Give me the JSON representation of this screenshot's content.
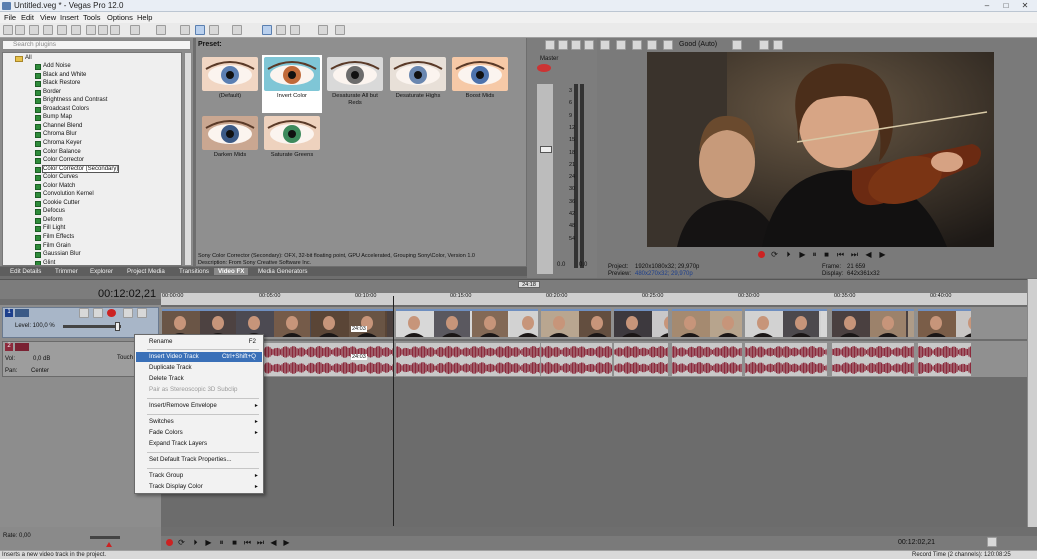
{
  "window": {
    "title": "Untitled.veg * - Vegas Pro 12.0",
    "minimize": "–",
    "maximize": "□",
    "close": "✕"
  },
  "menu": [
    "File",
    "Edit",
    "View",
    "Insert",
    "Tools",
    "Options",
    "Help"
  ],
  "fx": {
    "search_placeholder": "Search plugins",
    "root": "All",
    "items": [
      "Add Noise",
      "Black and White",
      "Black Restore",
      "Border",
      "Brightness and Contrast",
      "Broadcast Colors",
      "Bump Map",
      "Channel Blend",
      "Chroma Blur",
      "Chroma Keyer",
      "Color Balance",
      "Color Corrector",
      "Color Corrector (Secondary)",
      "Color Curves",
      "Color Match",
      "Convolution Kernel",
      "Cookie Cutter",
      "Defocus",
      "Deform",
      "Fill Light",
      "Film Effects",
      "Film Grain",
      "Gaussian Blur",
      "Glint"
    ],
    "selected": "Color Corrector (Secondary)"
  },
  "presets": {
    "label": "Preset:",
    "items": [
      "(Default)",
      "Invert Color",
      "Desaturate All but Reds",
      "Desaturate Highs",
      "Boost Mids",
      "Darken Mids",
      "Saturate Greens"
    ],
    "selected": "Invert Color",
    "description_line1": "Sony Color Corrector (Secondary): OFX, 32-bit floating point, GPU Accelerated, Grouping Sony\\Color, Version 1.0",
    "description_line2": "Description: From Sony Creative Software Inc."
  },
  "tabs": [
    "Edit Details",
    "Trimmer",
    "Explorer",
    "Project Media",
    "Transitions",
    "Video FX",
    "Media Generators"
  ],
  "active_tab": "Video FX",
  "mixer": {
    "label": "Master",
    "scale": [
      "3",
      "6",
      "9",
      "12",
      "15",
      "18",
      "21",
      "24",
      "30",
      "36",
      "42",
      "48",
      "54"
    ],
    "bottom_left": "0.0",
    "bottom_right": "0.0"
  },
  "preview": {
    "quality": "Good (Auto)",
    "project_label": "Project:",
    "project_value": "1920x1080x32; 29,970p",
    "preview_label": "Preview:",
    "preview_value": "480x270x32; 29,970p",
    "frame_label": "Frame:",
    "frame_value": "21 659",
    "display_label": "Display:",
    "display_value": "642x361x32"
  },
  "timeline": {
    "timecode": "00:12:02,21",
    "selection_length": "24:18",
    "ruler": [
      "00:00:00",
      "00:05:00",
      "00:10:00",
      "00:15:00",
      "00:20:00",
      "00:25:00",
      "00:30:00",
      "00:35:00",
      "00:40:00"
    ],
    "video_track": {
      "number": "1",
      "level": "Level: 100,0 %"
    },
    "audio_track": {
      "number": "2",
      "vol_label": "Vol:",
      "vol_value": "0,0 dB",
      "pan_label": "Pan:",
      "pan_value": "Center",
      "touch": "Touch"
    },
    "clip_markers": [
      "24:03",
      "24:03"
    ]
  },
  "context_menu": [
    {
      "label": "Rename",
      "shortcut": "F2",
      "state": "normal"
    },
    {
      "label": "Insert Video Track",
      "shortcut": "Ctrl+Shift+Q",
      "state": "highlighted"
    },
    {
      "label": "Duplicate Track",
      "shortcut": "",
      "state": "normal"
    },
    {
      "label": "Delete Track",
      "shortcut": "",
      "state": "normal"
    },
    {
      "label": "Pair as Stereoscopic 3D Subclip",
      "shortcut": "",
      "state": "disabled"
    },
    {
      "label": "Insert/Remove Envelope",
      "shortcut": "",
      "state": "submenu"
    },
    {
      "label": "Switches",
      "shortcut": "",
      "state": "submenu"
    },
    {
      "label": "Fade Colors",
      "shortcut": "",
      "state": "submenu"
    },
    {
      "label": "Expand Track Layers",
      "shortcut": "",
      "state": "normal"
    },
    {
      "label": "Set Default Track Properties...",
      "shortcut": "",
      "state": "normal"
    },
    {
      "label": "Track Group",
      "shortcut": "",
      "state": "submenu"
    },
    {
      "label": "Track Display Color",
      "shortcut": "",
      "state": "submenu"
    }
  ],
  "transport": {
    "rate_label": "Rate: 0,00",
    "end_timecode": "00:12:02,21"
  },
  "status": {
    "message": "Inserts a new video track in the project.",
    "record_time": "Record Time (2 channels): 120:08:25"
  },
  "colors": {
    "audio_wave": "#8c2a3c",
    "highlight": "#3a70b8",
    "selected_preset_bg": "#ffffff"
  }
}
